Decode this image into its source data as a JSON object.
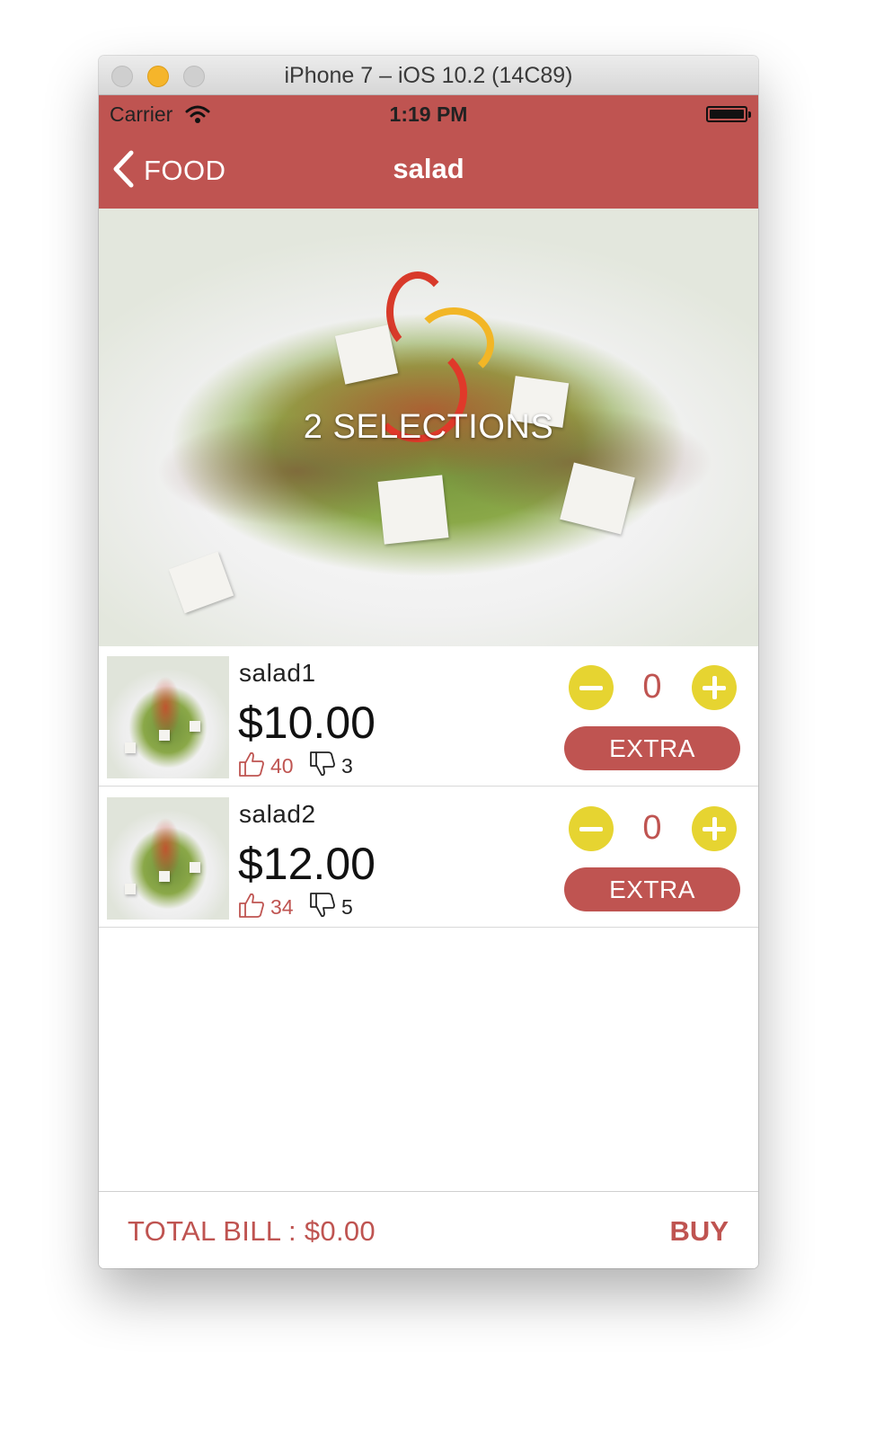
{
  "window": {
    "title": "iPhone 7 – iOS 10.2 (14C89)"
  },
  "status_bar": {
    "carrier": "Carrier",
    "time": "1:19 PM"
  },
  "nav": {
    "back_label": "FOOD",
    "title": "salad"
  },
  "hero": {
    "overlay_text": "2 SELECTIONS"
  },
  "items": [
    {
      "name": "salad1",
      "price": "$10.00",
      "likes": "40",
      "dislikes": "3",
      "quantity": "0",
      "extra_label": "EXTRA"
    },
    {
      "name": "salad2",
      "price": "$12.00",
      "likes": "34",
      "dislikes": "5",
      "quantity": "0",
      "extra_label": "EXTRA"
    }
  ],
  "footer": {
    "total_bill": "TOTAL BILL : $0.00",
    "buy_label": "BUY"
  },
  "colors": {
    "brand": "#bf5451",
    "accent_yellow": "#e6d431"
  }
}
